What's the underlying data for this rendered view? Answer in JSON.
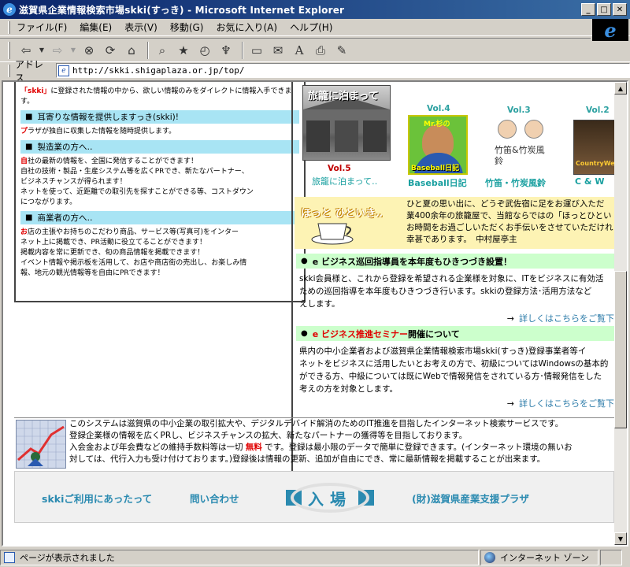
{
  "window": {
    "title": "滋賀県企業情報検索市場skki(すっき) - Microsoft Internet Explorer"
  },
  "menu": [
    "ファイル(F)",
    "編集(E)",
    "表示(V)",
    "移動(G)",
    "お気に入り(A)",
    "ヘルプ(H)"
  ],
  "address": {
    "label": "アドレス",
    "url": "http://skki.shigaplaza.or.jp/top/"
  },
  "left_panel": {
    "intro_prefix": "「skki」",
    "intro": "に登録された情報の中から、欲しい情報のみをダイレクトに情報入手できます。",
    "sections": [
      {
        "heading": "耳寄りな情報を提供しますっき(skki)!",
        "lead": "プ",
        "body": [
          "ラザが独自に収集した情報を随時提供します。"
        ]
      },
      {
        "heading": "製造業の方へ‥",
        "lead": "自",
        "body": [
          "社の最新の情報を、全国に発信することができます！",
          "自社の技術・製品・生産システム等を広くPRでき、新たなパートナー、",
          "ビジネスチャンスが得られます！",
          "ネットを使って、近距離での取引先を探すことができる等、コストダウン",
          "につながります。"
        ]
      },
      {
        "heading": "商業者の方へ‥",
        "lead": "お",
        "body": [
          "店の主張やお持ちのこだわり商品、サービス等(写真可)をインター",
          "ネット上に掲載でき、PR活動に役立てることができます！",
          "掲載内容を常に更新でき、旬の商品情報を掲載できます！",
          "イベント情報や掲示板を活用して、お店や商店街の売出し、お楽しみ情",
          "報、地元の観光情報等を自由にPRできます！"
        ]
      }
    ]
  },
  "features": [
    {
      "vol": "Vol.5",
      "caption": "旅籠に泊まって‥",
      "img_text": "旅籠に泊まって"
    },
    {
      "vol": "Vol.4",
      "caption": "Baseball日記",
      "img_text": "Baseball日記",
      "img_sub": "Mr.杉の"
    },
    {
      "vol": "Vol.3",
      "caption": "竹笛・竹炭風鈴",
      "img_text": "竹笛&竹炭風鈴"
    },
    {
      "vol": "Vol.2",
      "caption": "C & W",
      "img_text": "CountryWest"
    }
  ],
  "hotto": {
    "logo": "ほっと ひといき‥",
    "lines": [
      "ひと夏の思い出に、どうぞ武佐宿に足をお運び入ただ",
      "業400余年の旅籠屋で、当館ならではの「ほっとひとい",
      "お時間をお過ごしいただくお手伝いをさせていただけれ",
      "幸甚であります。　中村屋亭主"
    ]
  },
  "news": [
    {
      "title_plain": "e ビジネス巡回指導員を本年度もひきつづき設置！",
      "title_red": "",
      "title_suffix": "",
      "body": [
        "skki会員様と、これから登録を希望される企業様を対象に、ITをビジネスに有効活",
        "ための巡回指導を本年度もひきつづき行います。skkiの登録方法･活用方法など",
        "えします。"
      ],
      "link": "詳しくはこちらをご覧下"
    },
    {
      "title_plain": "",
      "title_red": "e ビジネス推進セミナー",
      "title_suffix": "開催について",
      "body": [
        "県内の中小企業者および滋賀県企業情報検索市場skki(すっき)登録事業者等イ",
        "ネットをビジネスに活用したいとお考えの方で、初級についてはWindowsの基本的",
        "ができる方、中級については既にWebで情報発信をされている方･情報発信をした",
        "考えの方を対象とします。"
      ],
      "link": "詳しくはこちらをご覧下"
    }
  ],
  "description": {
    "lines": [
      "このシステムは滋賀県の中小企業の取引拡大や、デジタルデバイド解消のためのIT推進を目指したインターネット検索サービスです。",
      "登録企業様の情報を広くPRし、ビジネスチャンスの拡大、新たなパートナーの獲得等を目指しております。"
    ],
    "line3_a": "入会金および年会費などの維持手数料等は一切 ",
    "line3_red": "無料",
    "line3_b": " です。登録は最小限のデータで簡単に登録できます。(インターネット環境の無いお",
    "line4": "対しては、代行入力も受け付けております。)登録後は情報の更新、追加が自由にでき、常に最新情報を掲載することが出来ます。"
  },
  "footer": {
    "usage": "skkiご利用にあったって",
    "contact": "問い合わせ",
    "enter": "入場",
    "org": "(財)滋賀県産業支援プラザ"
  },
  "status": {
    "message": "ページが表示されました",
    "zone": "インターネット ゾーン"
  }
}
